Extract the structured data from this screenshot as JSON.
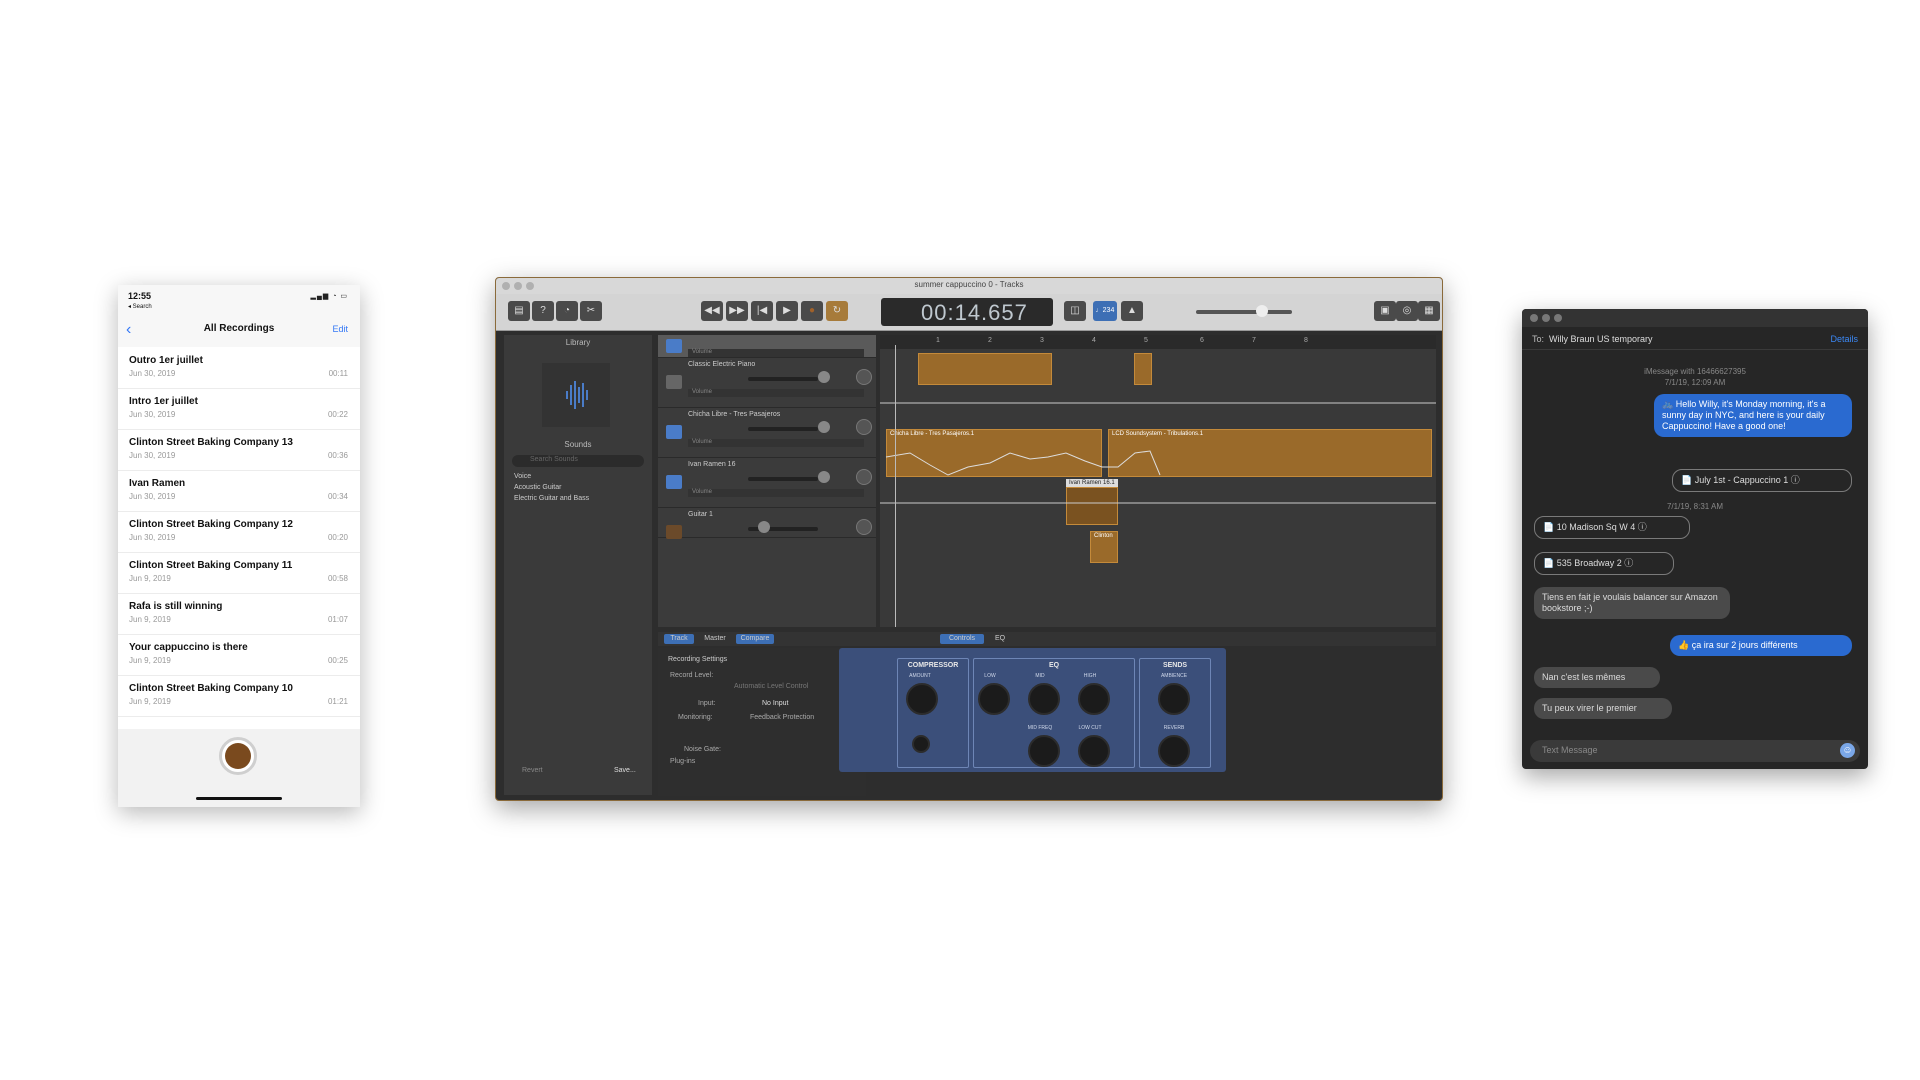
{
  "voice_memos": {
    "status_time": "12:55",
    "back_label": "◂ Search",
    "nav_title": "All Recordings",
    "edit_label": "Edit",
    "recordings": [
      {
        "title": "Outro 1er juillet",
        "date": "Jun 30, 2019",
        "duration": "00:11"
      },
      {
        "title": "Intro 1er juillet",
        "date": "Jun 30, 2019",
        "duration": "00:22"
      },
      {
        "title": "Clinton Street Baking Company 13",
        "date": "Jun 30, 2019",
        "duration": "00:36"
      },
      {
        "title": "Ivan Ramen",
        "date": "Jun 30, 2019",
        "duration": "00:34"
      },
      {
        "title": "Clinton Street Baking Company 12",
        "date": "Jun 30, 2019",
        "duration": "00:20"
      },
      {
        "title": "Clinton Street Baking Company 11",
        "date": "Jun 9, 2019",
        "duration": "00:58"
      },
      {
        "title": "Rafa is still winning",
        "date": "Jun 9, 2019",
        "duration": "01:07"
      },
      {
        "title": "Your cappuccino is there",
        "date": "Jun 9, 2019",
        "duration": "00:25"
      },
      {
        "title": "Clinton Street Baking Company 10",
        "date": "Jun 9, 2019",
        "duration": "01:21"
      }
    ]
  },
  "garageband": {
    "window_title": "summer cappuccino 0 - Tracks",
    "time_display": "00:14.657",
    "tempo_display": "♩234",
    "library": {
      "header": "Library",
      "sounds_label": "Sounds",
      "search_placeholder": "Search Sounds",
      "categories": [
        "Voice",
        "Acoustic Guitar",
        "Electric Guitar and Bass"
      ],
      "revert_label": "Revert",
      "save_label": "Save..."
    },
    "tracks": [
      {
        "name": "",
        "volume_label": "Volume"
      },
      {
        "name": "Classic Electric Piano",
        "volume_label": "Volume"
      },
      {
        "name": "Chicha Libre - Tres Pasajeros",
        "volume_label": "Volume"
      },
      {
        "name": "Ivan Ramen 16",
        "volume_label": "Volume"
      },
      {
        "name": "Guitar 1",
        "volume_label": ""
      }
    ],
    "ruler_marks": [
      "1",
      "2",
      "3",
      "4",
      "5",
      "6",
      "7",
      "8"
    ],
    "regions": [
      {
        "label": "Chicha Libre - Tres Pasajeros.1"
      },
      {
        "label": "LCD Soundsystem - Tribulations.1"
      },
      {
        "label": "Ivan Ramen 16.1"
      },
      {
        "label": "Clinton"
      }
    ],
    "bottom_tabs": [
      "Track",
      "Master",
      "Compare",
      "Controls",
      "EQ"
    ],
    "recording_settings": {
      "title": "Recording Settings",
      "record_level": "Record Level:",
      "auto_level": "Automatic Level Control",
      "input_label": "Input:",
      "input_value": "No Input",
      "monitoring": "Monitoring:",
      "feedback": "Feedback Protection",
      "noise_gate": "Noise Gate:",
      "plugins": "Plug-ins"
    },
    "smart_controls": {
      "compressor": {
        "title": "COMPRESSOR",
        "amount": "AMOUNT"
      },
      "eq": {
        "title": "EQ",
        "low": "LOW",
        "mid": "MID",
        "high": "HIGH",
        "mid_freq": "MID FREQ",
        "low_cut": "LOW CUT"
      },
      "sends": {
        "title": "SENDS",
        "ambience": "AMBIENCE",
        "reverb": "REVERB"
      }
    }
  },
  "messages": {
    "to_label": "To:",
    "recipient": "Willy Braun US temporary",
    "details_label": "Details",
    "meta1": "iMessage with 16466627395",
    "meta2": "7/1/19, 12:09 AM",
    "meta3": "7/1/19, 8:31 AM",
    "bubbles": [
      {
        "dir": "out",
        "text": "🚲 Hello Willy, it's Monday morning, it's a sunny day in NYC, and here is your daily Cappuccino! Have a good one!"
      },
      {
        "dir": "out_file",
        "text": "July 1st - Cappuccino 1"
      },
      {
        "dir": "in_file",
        "text": "10 Madison Sq W 4"
      },
      {
        "dir": "in_file",
        "text": "535 Broadway 2"
      },
      {
        "dir": "in",
        "text": "Tiens en fait je voulais balancer sur Amazon bookstore ;-)"
      },
      {
        "dir": "out",
        "text": "👍 ça ira sur 2 jours différents"
      },
      {
        "dir": "in",
        "text": "Nan c'est les mêmes"
      },
      {
        "dir": "in",
        "text": "Tu peux virer le premier"
      }
    ],
    "input_placeholder": "Text Message"
  }
}
